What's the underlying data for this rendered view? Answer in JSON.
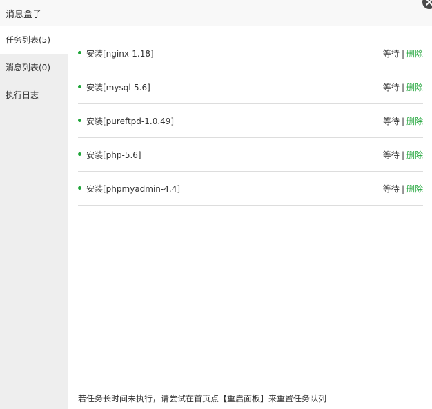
{
  "window": {
    "title": "消息盒子"
  },
  "sidebar": {
    "tabs": [
      {
        "label": "任务列表(5)",
        "active": true
      },
      {
        "label": "消息列表(0)",
        "active": false
      },
      {
        "label": "执行日志",
        "active": false
      }
    ]
  },
  "tasks": [
    {
      "name": "安装[nginx-1.18]",
      "status": "等待",
      "separator": "|",
      "action": "删除"
    },
    {
      "name": "安装[mysql-5.6]",
      "status": "等待",
      "separator": "|",
      "action": "删除"
    },
    {
      "name": "安装[pureftpd-1.0.49]",
      "status": "等待",
      "separator": "|",
      "action": "删除"
    },
    {
      "name": "安装[php-5.6]",
      "status": "等待",
      "separator": "|",
      "action": "删除"
    },
    {
      "name": "安装[phpmyadmin-4.4]",
      "status": "等待",
      "separator": "|",
      "action": "删除"
    }
  ],
  "footer": {
    "note": "若任务长时间未执行，请尝试在首页点【重启面板】来重置任务队列"
  },
  "colors": {
    "accent": "#20a53a",
    "sidebar_bg": "#eeeeee",
    "titlebar_bg": "#f8f8f8",
    "divider": "#dddddd"
  }
}
